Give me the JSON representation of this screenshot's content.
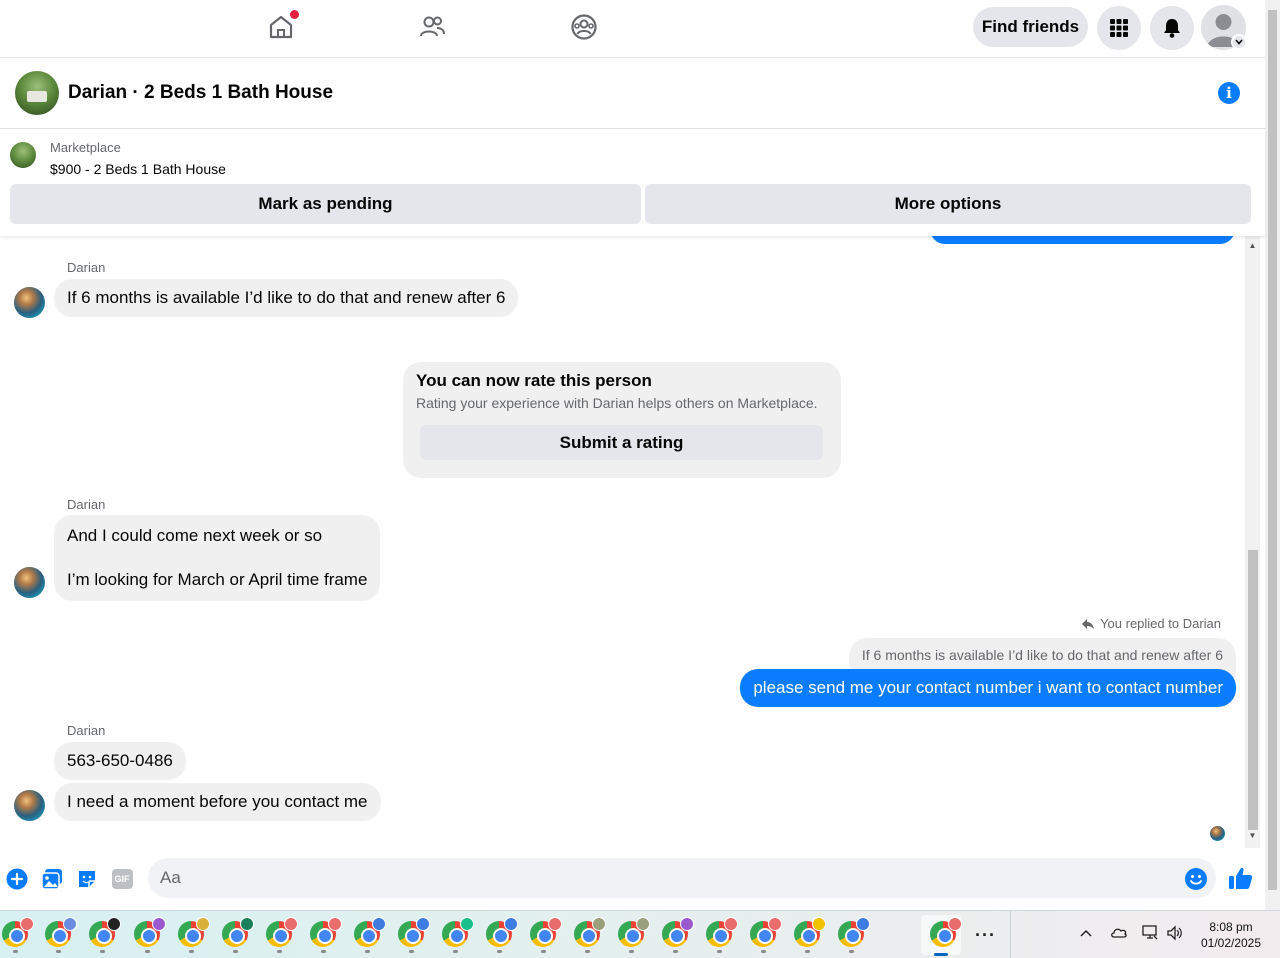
{
  "nav": {
    "find_friends_label": "Find friends",
    "colors": {
      "accent": "#0a7cff",
      "notification_dot": "#e41e3f",
      "button_bg": "#e4e6eb"
    }
  },
  "chat": {
    "title": "Darian · 2 Beds 1 Bath House"
  },
  "marketplace": {
    "label": "Marketplace",
    "listing": "$900 - 2 Beds 1 Bath House",
    "mark_pending_label": "Mark as pending",
    "more_options_label": "More options"
  },
  "messages": {
    "sender": "Darian",
    "msg1": "If 6 months is available I’d like to do that and renew after 6",
    "rating": {
      "title": "You can now rate this person",
      "subtitle": "Rating your experience with Darian helps others on Marketplace.",
      "button": "Submit a rating"
    },
    "msg2_line1": "And I could come next week or so",
    "msg2_line2": "I’m looking for March or April time frame",
    "reply_note": "You replied to Darian",
    "reply_quote": "If 6 months is available I’d like to do that and renew after 6",
    "my_msg": "please send me your contact number i want to contact number",
    "msg3": "563-650-0486",
    "msg4": "I need a moment before you contact me"
  },
  "composer": {
    "placeholder": "Aa",
    "gif_label": "GIF"
  },
  "taskbar": {
    "more": "···",
    "time": "8:08 pm",
    "date": "01/02/2025",
    "badge_colors": [
      "#e96d6d",
      "#6a8de0",
      "#222222",
      "#9b59d0",
      "#d9b13a",
      "#1a7f5a",
      "#e96d6d",
      "#e96d6d",
      "#3d7be0",
      "#3d7be0",
      "#1bbf8a",
      "#3d7be0",
      "#e96d6d",
      "#9aa07a",
      "#9aa07a",
      "#9b59d0",
      "#e96d6d",
      "#e96d6d",
      "#f2c200",
      "#3d7be0",
      "#e96d6d"
    ]
  }
}
